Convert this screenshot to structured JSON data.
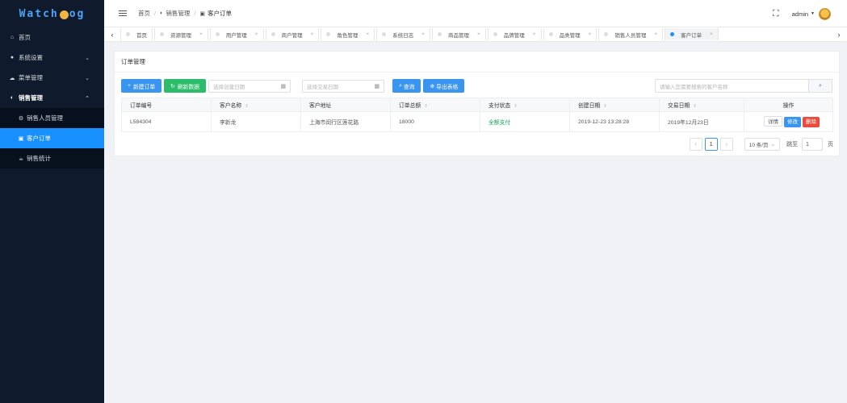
{
  "sidebar": {
    "logo": {
      "left": "Watch",
      "right": "og"
    },
    "items": [
      {
        "label": "首页",
        "icon": "home-icon"
      },
      {
        "label": "系统设置",
        "icon": "settings-icon"
      },
      {
        "label": "菜单管理",
        "icon": "cloud-icon"
      },
      {
        "label": "销售管理",
        "icon": "half-circle-icon"
      }
    ],
    "sub_items": [
      {
        "label": "销售人员管理",
        "icon": "gear-icon"
      },
      {
        "label": "客户订单",
        "icon": "lock-icon"
      },
      {
        "label": "销售统计",
        "icon": "coffee-icon"
      }
    ]
  },
  "header": {
    "breadcrumb": [
      "首页",
      "销售管理",
      "客户订单"
    ],
    "user": "admin"
  },
  "tabs": [
    "首页",
    "资源管理",
    "用户管理",
    "商户管理",
    "角色管理",
    "系统日志",
    "商品管理",
    "品牌管理",
    "品类管理",
    "销售人员管理",
    "客户订单"
  ],
  "panel": {
    "title": "订单管理",
    "toolbar": {
      "new_order": "新建订单",
      "refresh": "刷新数据",
      "create_date_placeholder": "选择创建日期",
      "deal_date_placeholder": "选择交易日期",
      "query": "查询",
      "export": "导出表格",
      "search_placeholder": "请输入您需要搜索的客户名称"
    },
    "table": {
      "headers": [
        "订单编号",
        "客户名称",
        "客户地址",
        "订单总额",
        "支付状态",
        "创建日期",
        "交易日期",
        "操作"
      ],
      "rows": [
        {
          "order_no": "L584304",
          "customer": "李新龙",
          "address": "上海市闵行区莲花路",
          "total": "18000",
          "pay_status": "全额支付",
          "created": "2019-12-23 13:28:28",
          "deal_date": "2019年12月23日",
          "actions": {
            "detail": "详情",
            "edit": "修改",
            "delete": "删除"
          }
        }
      ]
    },
    "pager": {
      "prev": "‹",
      "current_page": "1",
      "next": "›",
      "page_size": "10 条/页",
      "jump_label": "跳至",
      "jump_value": "1",
      "page_suffix": "页"
    }
  },
  "colors": {
    "primary": "#1890ff",
    "sidebar_bg": "#0f1b2d",
    "success": "#2dbd6a",
    "danger": "#e84c3d"
  }
}
